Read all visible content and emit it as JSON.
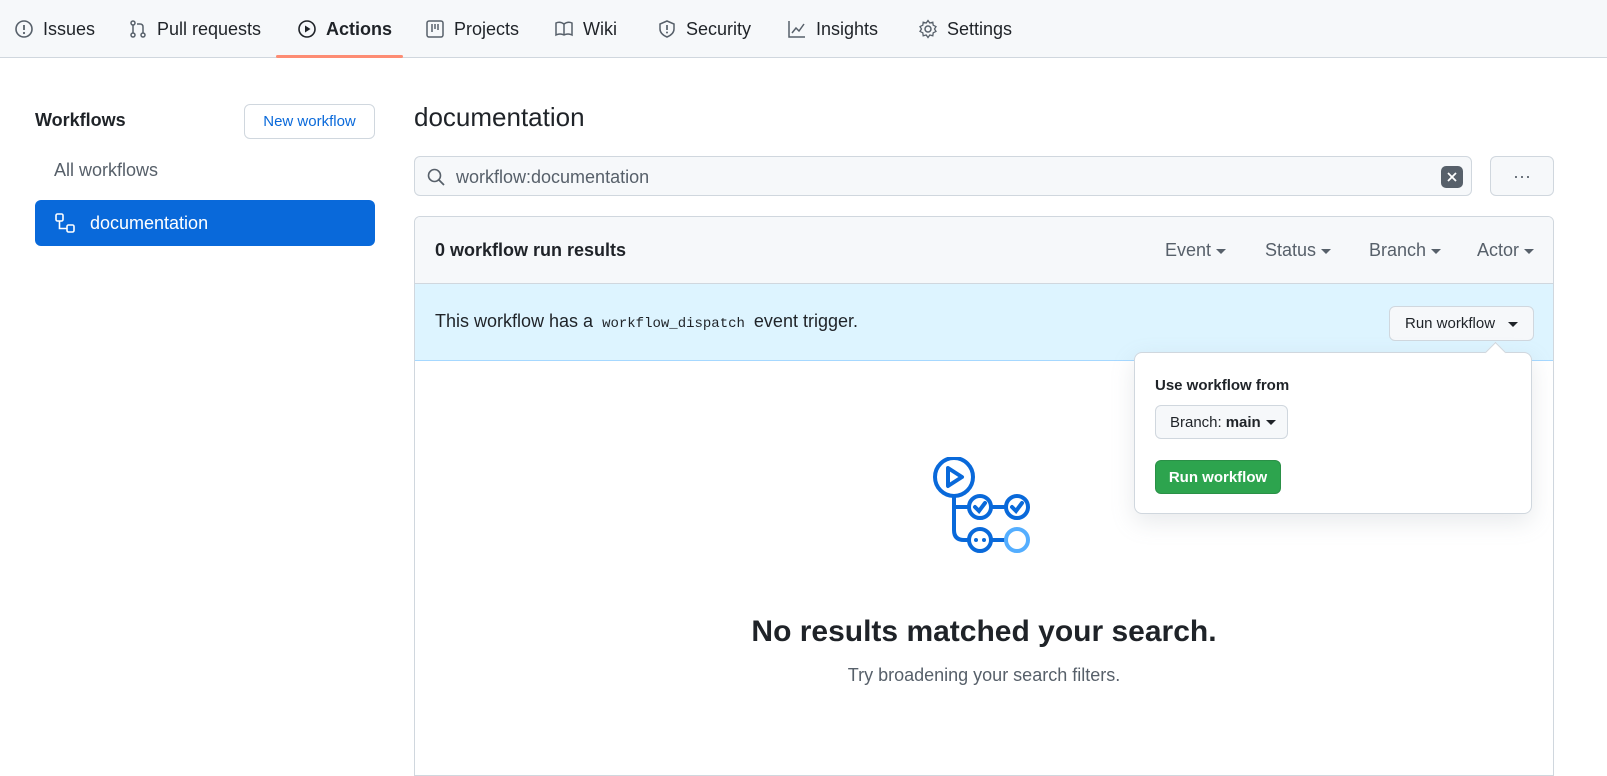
{
  "nav": {
    "tabs": [
      {
        "label": "Issues",
        "icon": "issue-icon"
      },
      {
        "label": "Pull requests",
        "icon": "pull-request-icon"
      },
      {
        "label": "Actions",
        "icon": "play-icon",
        "active": true
      },
      {
        "label": "Projects",
        "icon": "project-icon"
      },
      {
        "label": "Wiki",
        "icon": "book-icon"
      },
      {
        "label": "Security",
        "icon": "shield-icon"
      },
      {
        "label": "Insights",
        "icon": "graph-icon"
      },
      {
        "label": "Settings",
        "icon": "gear-icon"
      }
    ]
  },
  "sidebar": {
    "title": "Workflows",
    "new_workflow": "New workflow",
    "all_workflows": "All workflows",
    "selected_workflow": "documentation"
  },
  "main": {
    "title": "documentation",
    "search_value": "workflow:documentation",
    "more_label": "···",
    "results_count": "0 workflow run results",
    "filters": [
      "Event",
      "Status",
      "Branch",
      "Actor"
    ],
    "dispatch": {
      "prefix": "This workflow has a",
      "code": "workflow_dispatch",
      "suffix": "event trigger.",
      "run_button": "Run workflow"
    },
    "empty": {
      "title": "No results matched your search.",
      "subtitle": "Try broadening your search filters."
    }
  },
  "popover": {
    "label": "Use workflow from",
    "branch_prefix": "Branch:",
    "branch_value": "main",
    "run_button": "Run workflow"
  },
  "colors": {
    "accent": "#0969da",
    "tab_underline": "#fd8c73",
    "success": "#2da44e",
    "dispatch_bg": "#ddf4ff"
  }
}
